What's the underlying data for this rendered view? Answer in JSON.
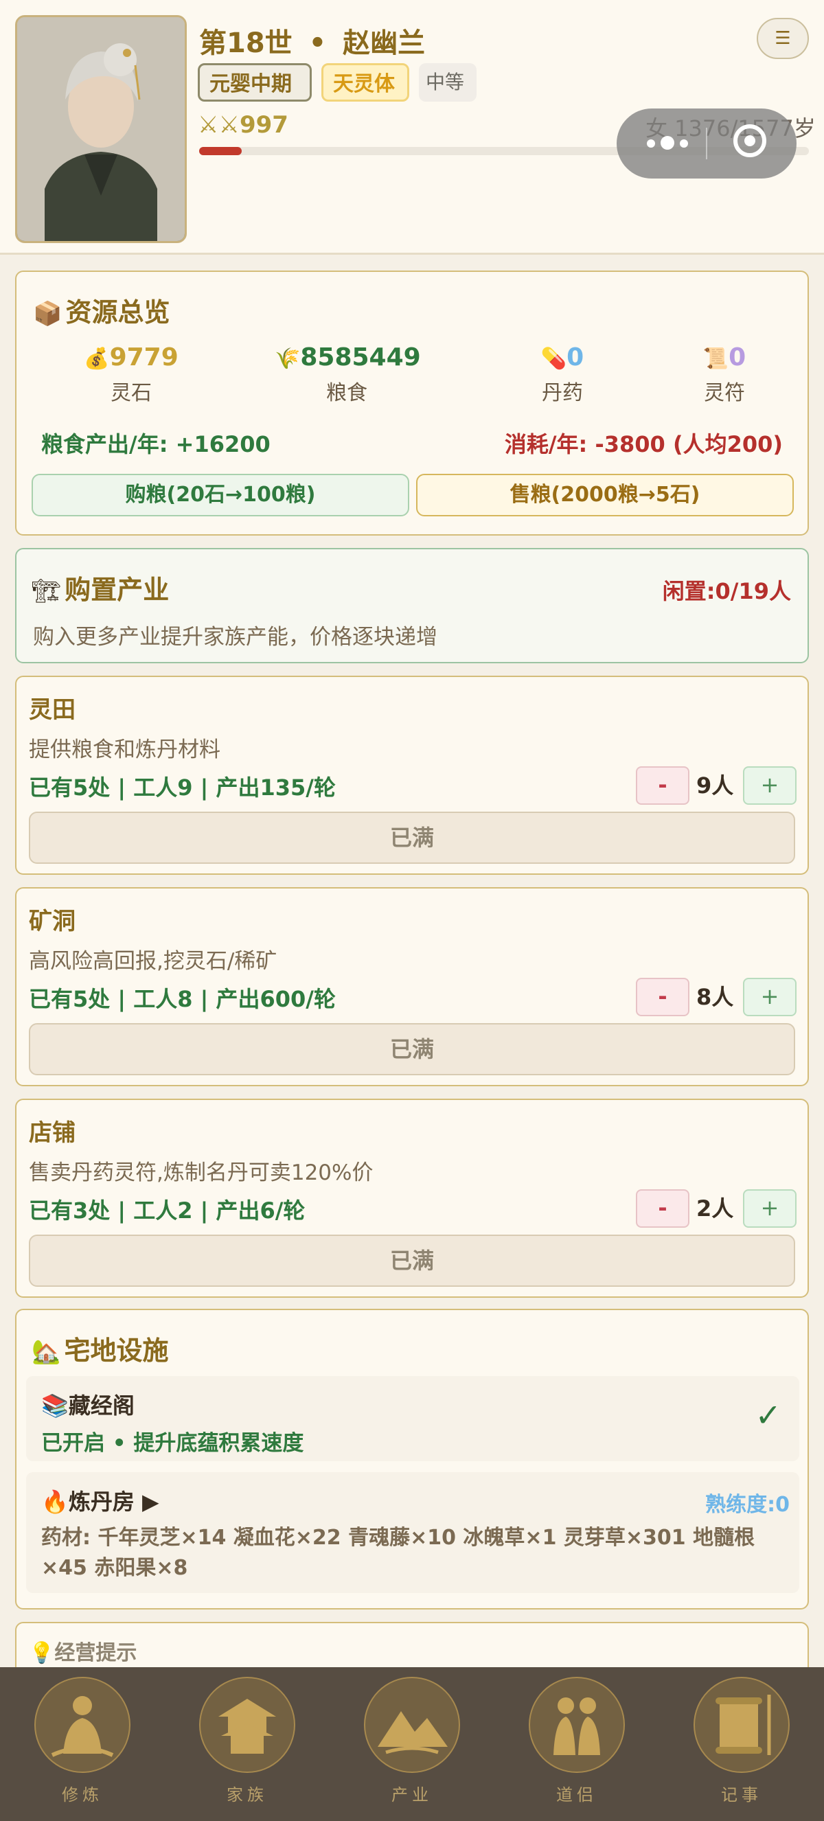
{
  "header": {
    "generation": "第18世",
    "separator": "•",
    "name": "赵幽兰",
    "realm_tag": "元婴中期",
    "body_tag": "天灵体",
    "grade_tag": "中等",
    "power_icon": "crossed-swords-icon",
    "power_value": "997",
    "age_text": "女 1376/1577岁",
    "life_fraction": 0.07,
    "menu_icon": "menu-icon"
  },
  "resources": {
    "title": "资源总览",
    "items": [
      {
        "icon": "money-bag-icon",
        "value": "9779",
        "label": "灵石",
        "color": "#c9a234"
      },
      {
        "icon": "grain-icon",
        "value": "8585449",
        "label": "粮食",
        "color": "#2f7a3e"
      },
      {
        "icon": "pill-icon",
        "value": "0",
        "label": "丹药",
        "color": "#6fb6e8"
      },
      {
        "icon": "scroll-icon",
        "value": "0",
        "label": "灵符",
        "color": "#b79be0"
      }
    ],
    "production_text": "粮食产出/年: +16200",
    "consumption_text": "消耗/年: -3800 (人均200)",
    "buy_label": "购粮(20石→100粮)",
    "sell_label": "售粮(2000粮→5石)"
  },
  "purchase": {
    "title": "购置产业",
    "idle_text": "闲置:0/19人",
    "description": "购入更多产业提升家族产能，价格逐块递增"
  },
  "industries": [
    {
      "name": "灵田",
      "desc": "提供粮食和炼丹材料",
      "stats": "已有5处 | 工人9 | 产出135/轮",
      "minus": "-",
      "plus": "+",
      "workers": "9人",
      "status": "已满"
    },
    {
      "name": "矿洞",
      "desc": "高风险高回报,挖灵石/稀矿",
      "stats": "已有5处 | 工人8 | 产出600/轮",
      "minus": "-",
      "plus": "+",
      "workers": "8人",
      "status": "已满"
    },
    {
      "name": "店铺",
      "desc": "售卖丹药灵符,炼制名丹可卖120%价",
      "stats": "已有3处 | 工人2 | 产出6/轮",
      "minus": "-",
      "plus": "+",
      "workers": "2人",
      "status": "已满"
    }
  ],
  "estate": {
    "title": "宅地设施",
    "library": {
      "name": "藏经阁",
      "status": "已开启 • 提升底蕴积累速度",
      "check": "✓"
    },
    "alchemy": {
      "name": "炼丹房 ▶",
      "proficiency": "熟练度:0",
      "materials": "药材: 千年灵芝×14 凝血花×22 青魂藤×10 冰魄草×1 灵芽草×301 地髓根×45 赤阳果×8"
    }
  },
  "tips": {
    "title": "经营提示"
  },
  "nav": [
    {
      "label": "修炼",
      "icon": "meditation-icon"
    },
    {
      "label": "家族",
      "icon": "pavilion-icon"
    },
    {
      "label": "产业",
      "icon": "landscape-icon"
    },
    {
      "label": "道侣",
      "icon": "couple-icon"
    },
    {
      "label": "记事",
      "icon": "scroll-record-icon"
    }
  ]
}
